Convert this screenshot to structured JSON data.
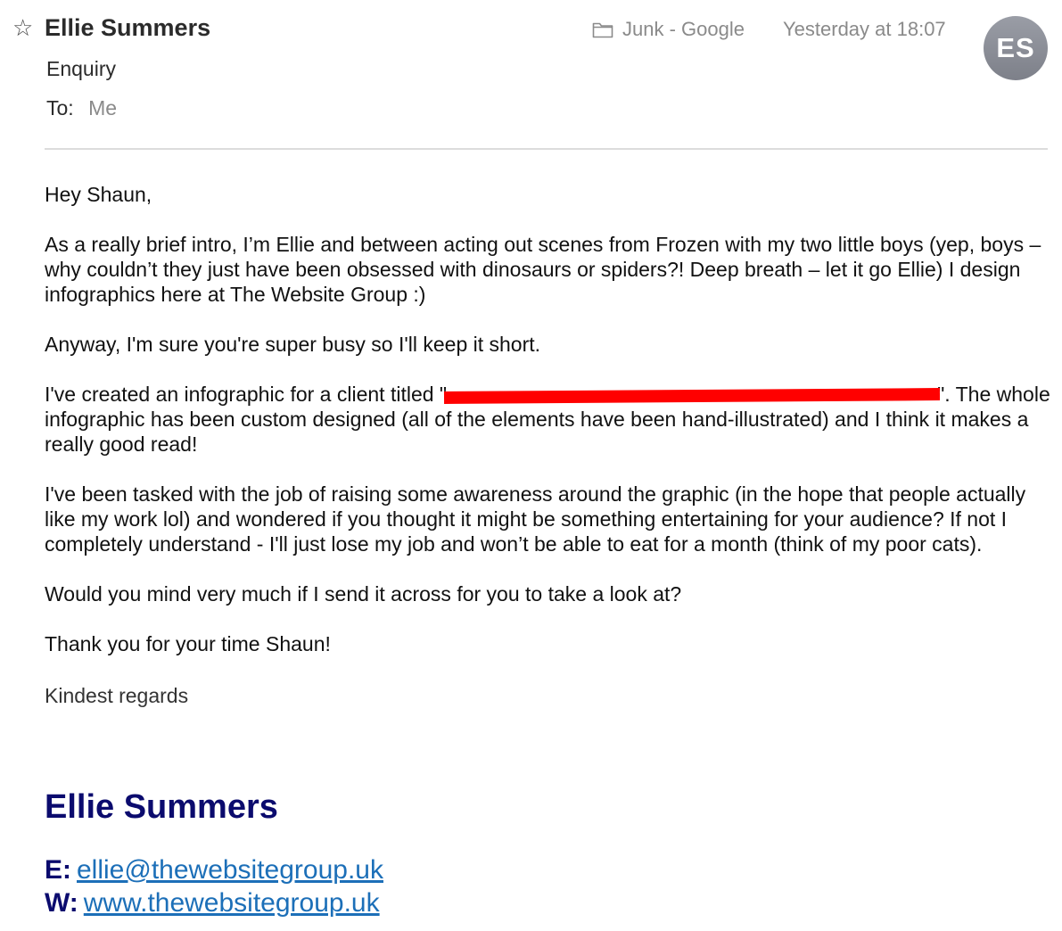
{
  "header": {
    "star_glyph": "☆",
    "sender_name": "Ellie Summers",
    "mailbox": "Junk - Google",
    "timestamp": "Yesterday at 18:07",
    "avatar_initials": "ES",
    "subject": "Enquiry",
    "to_label": "To:",
    "to_value": "Me"
  },
  "body": {
    "greeting": "Hey Shaun,",
    "para1": "As a really brief intro, I’m Ellie and between acting out scenes from Frozen with my two little boys (yep, boys – why couldn’t they just have been obsessed with dinosaurs or spiders?! Deep breath – let it go Ellie) I design infographics here at The Website Group :)",
    "para2": "Anyway, I'm sure you're super busy so I'll keep it short.",
    "para3_before": "I've created an infographic for a client titled \"",
    "para3_after": "\". The whole infographic has been custom designed (all of the elements have been hand-illustrated) and I think it makes a really good read!",
    "para4": "I've been tasked with the job of raising some awareness around the graphic (in the hope that people actually like my work lol) and wondered if you thought it might be something entertaining for your audience? If not I completely understand - I'll just lose my job and won’t be able to eat for a month (think of my poor cats).",
    "para5": "Would you mind very much if I send it across for you to take a look at?",
    "para6": "Thank you for your time Shaun!",
    "signoff": "Kindest regards"
  },
  "signature": {
    "name": "Ellie Summers",
    "email_label": "E:",
    "email": "ellie@thewebsitegroup.uk",
    "web_label": "W:",
    "web": "www.thewebsitegroup.uk"
  },
  "colors": {
    "signature_name": "#0b0b6e",
    "link": "#1c6fb8",
    "redaction": "#ff0000",
    "avatar": "#8a8d96"
  },
  "icons": {
    "star": "star-outline-icon",
    "folder": "folder-icon"
  }
}
